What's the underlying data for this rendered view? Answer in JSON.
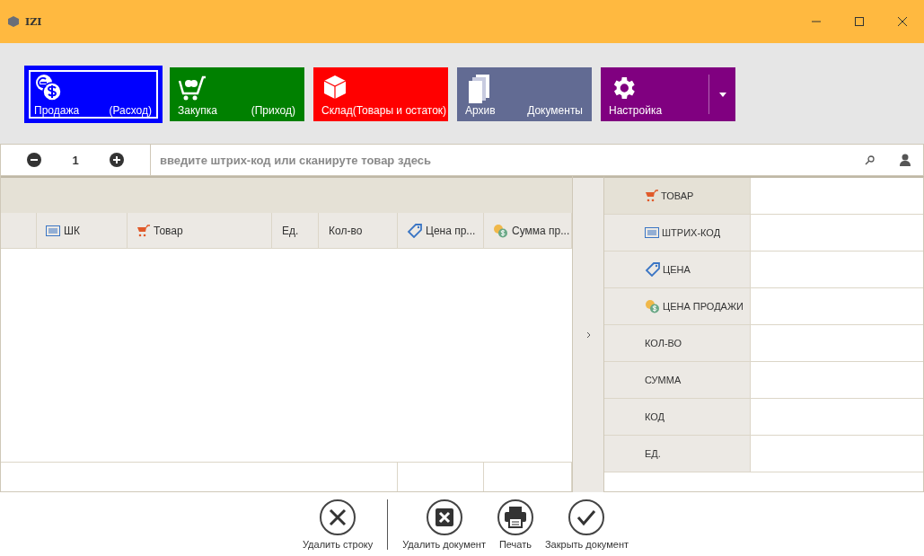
{
  "window": {
    "title": "IZI"
  },
  "tiles": [
    {
      "label": "Продажа",
      "secondary": "(Расход)",
      "color": "#0000ff",
      "selected": true,
      "dropdown": false
    },
    {
      "label": "Закупка",
      "secondary": "(Приход)",
      "color": "#008000",
      "selected": false,
      "dropdown": false
    },
    {
      "label": "Склад(Товары и остаток)",
      "color": "#ff0000",
      "selected": false,
      "dropdown": false
    },
    {
      "label": "Архив",
      "secondary": "Документы",
      "color": "#626b93",
      "selected": false,
      "dropdown": false
    },
    {
      "label": "Настройка",
      "color": "#800080",
      "selected": false,
      "dropdown": true
    }
  ],
  "quantity": "1",
  "scan_field": {
    "placeholder": "введите штрих-код или сканируте товар здесь"
  },
  "table": {
    "columns": [
      "",
      "ШК",
      "Товар",
      "Ед.",
      "Кол-во",
      "Цена пр...",
      "Сумма пр..."
    ]
  },
  "details": [
    {
      "label": "ТОВАР",
      "selected": true
    },
    {
      "label": "ШТРИХ-КОД",
      "selected": false
    },
    {
      "label": "ЦЕНА",
      "selected": false
    },
    {
      "label": "ЦЕНА ПРОДАЖИ",
      "selected": false
    },
    {
      "label": "КОЛ-ВО",
      "selected": false
    },
    {
      "label": "СУММА",
      "selected": false
    },
    {
      "label": "КОД",
      "selected": false
    },
    {
      "label": "ЕД.",
      "selected": false
    }
  ],
  "row_actions": [
    "Удалить строку"
  ],
  "document_actions": [
    "Удалить документ",
    "Печать",
    "Закрыть документ"
  ]
}
